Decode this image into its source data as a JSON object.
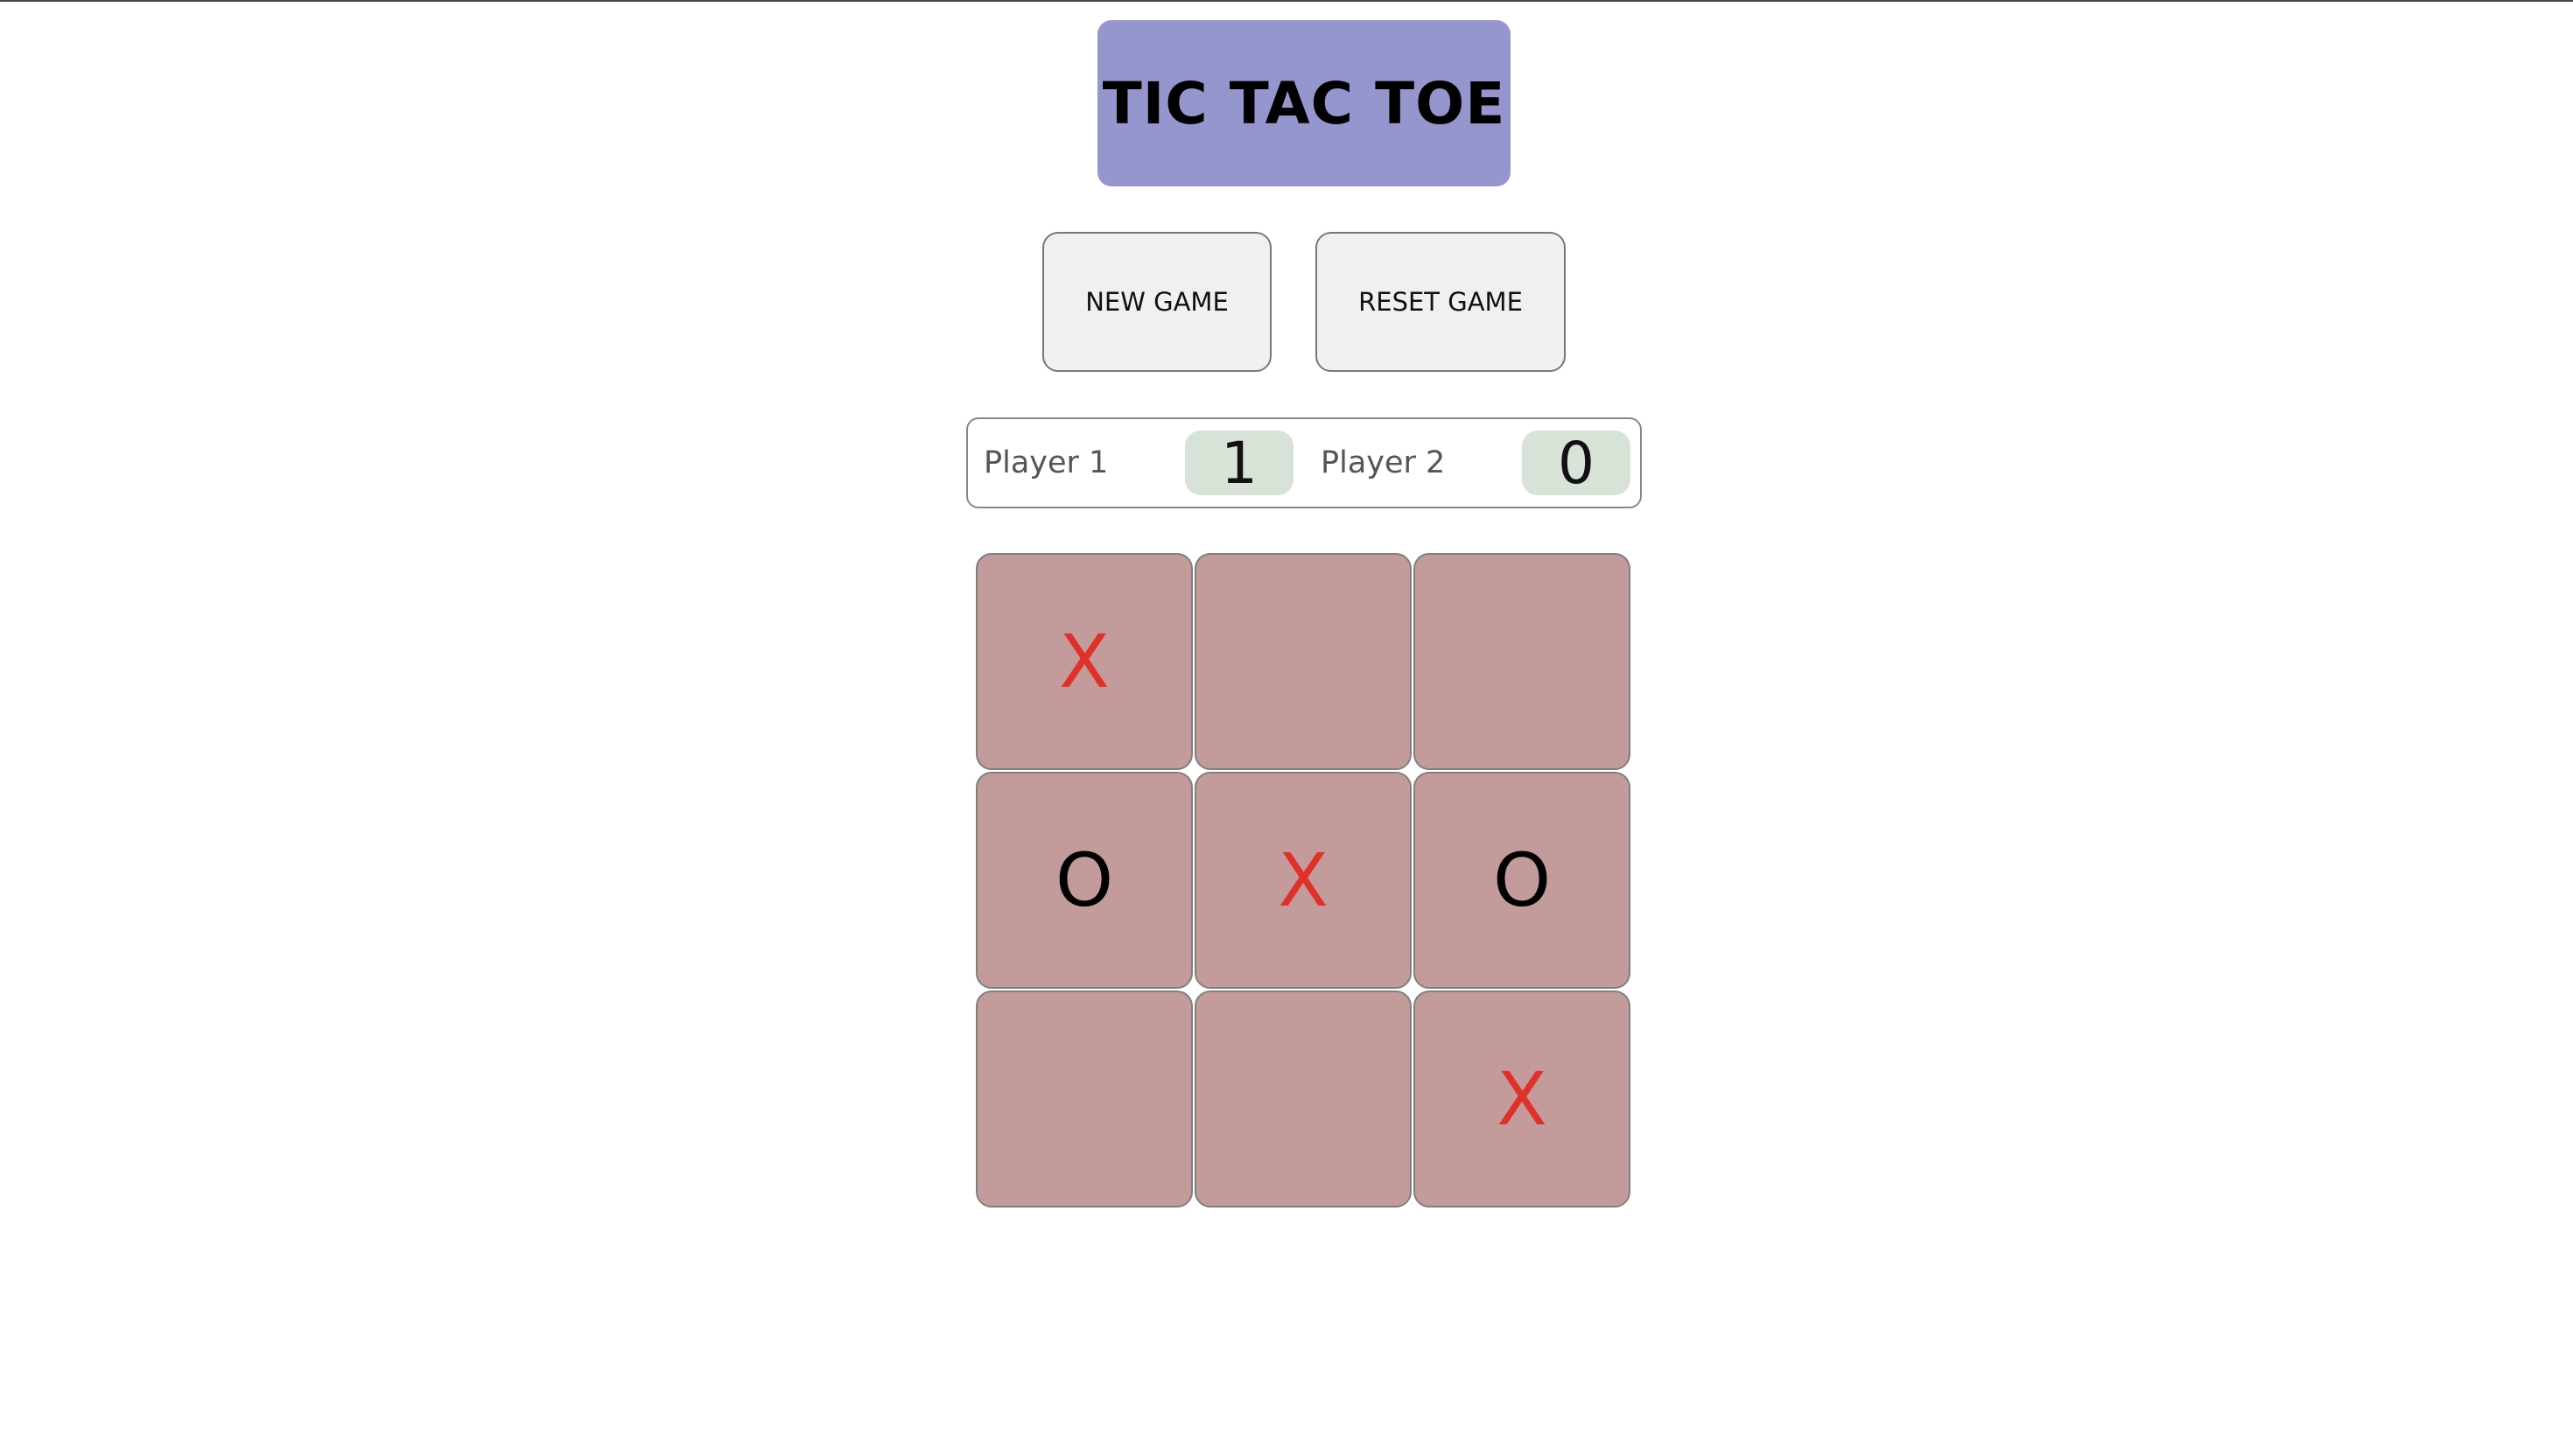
{
  "title": "TIC TAC TOE",
  "buttons": {
    "new_game": "NEW GAME",
    "reset_game": "RESET GAME"
  },
  "scoreboard": {
    "player1": {
      "name": "Player 1",
      "score": "1"
    },
    "player2": {
      "name": "Player 2",
      "score": "0"
    }
  },
  "board": {
    "cells": [
      "X",
      "",
      "",
      "O",
      "X",
      "O",
      "",
      "",
      "X"
    ]
  },
  "colors": {
    "title_bg": "#9696cf",
    "cell_bg": "#c49b9b",
    "x_mark": "#e0302a",
    "o_mark": "#000000",
    "score_bg": "#d8e3d8"
  }
}
